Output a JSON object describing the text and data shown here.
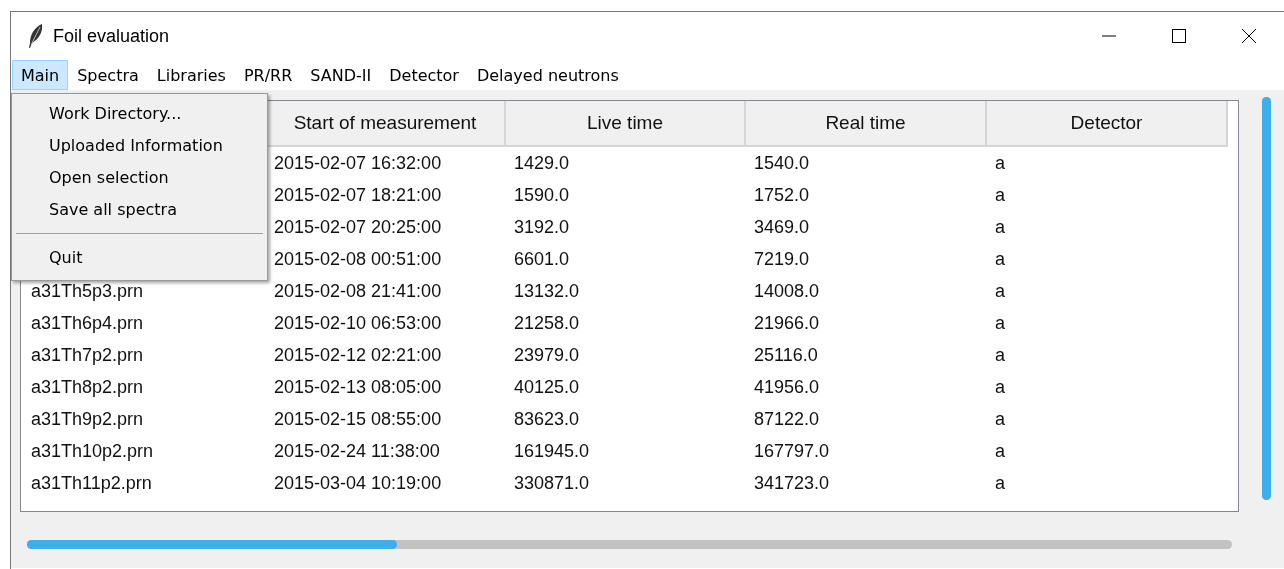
{
  "window": {
    "title": "Foil evaluation"
  },
  "menubar": [
    {
      "label": "Main",
      "selected": true
    },
    {
      "label": "Spectra",
      "selected": false
    },
    {
      "label": "Libraries",
      "selected": false
    },
    {
      "label": "PR/RR",
      "selected": false
    },
    {
      "label": "SAND-II",
      "selected": false
    },
    {
      "label": "Detector",
      "selected": false
    },
    {
      "label": "Delayed neutrons",
      "selected": false
    }
  ],
  "dropdown": {
    "items": [
      {
        "kind": "item",
        "label": "Work Directory..."
      },
      {
        "kind": "item",
        "label": "Uploaded Information"
      },
      {
        "kind": "item",
        "label": "Open selection"
      },
      {
        "kind": "item",
        "label": "Save all spectra"
      },
      {
        "kind": "separator"
      },
      {
        "kind": "item",
        "label": "Quit"
      }
    ]
  },
  "table": {
    "columns": [
      "Start of measurement",
      "Live time",
      "Real time",
      "Detector"
    ],
    "rows": [
      {
        "start": "2015-02-07 16:32:00",
        "live": "1429.0",
        "real": "1540.0",
        "detector": "a"
      },
      {
        "start": "2015-02-07 18:21:00",
        "live": "1590.0",
        "real": "1752.0",
        "detector": "a"
      },
      {
        "start": "2015-02-07 20:25:00",
        "live": "3192.0",
        "real": "3469.0",
        "detector": "a"
      },
      {
        "start": "2015-02-08 00:51:00",
        "live": "6601.0",
        "real": "7219.0",
        "detector": "a"
      },
      {
        "file": "a31Th5p3.prn",
        "start": "2015-02-08 21:41:00",
        "live": "13132.0",
        "real": "14008.0",
        "detector": "a"
      },
      {
        "file": "a31Th6p4.prn",
        "start": "2015-02-10 06:53:00",
        "live": "21258.0",
        "real": "21966.0",
        "detector": "a"
      },
      {
        "file": "a31Th7p2.prn",
        "start": "2015-02-12 02:21:00",
        "live": "23979.0",
        "real": "25116.0",
        "detector": "a"
      },
      {
        "file": "a31Th8p2.prn",
        "start": "2015-02-13 08:05:00",
        "live": "40125.0",
        "real": "41956.0",
        "detector": "a"
      },
      {
        "file": "a31Th9p2.prn",
        "start": "2015-02-15 08:55:00",
        "live": "83623.0",
        "real": "87122.0",
        "detector": "a"
      },
      {
        "file": "a31Th10p2.prn",
        "start": "2015-02-24 11:38:00",
        "live": "161945.0",
        "real": "167797.0",
        "detector": "a"
      },
      {
        "file": "a31Th11p2.prn",
        "start": "2015-03-04 10:19:00",
        "live": "330871.0",
        "real": "341723.0",
        "detector": "a"
      }
    ]
  }
}
